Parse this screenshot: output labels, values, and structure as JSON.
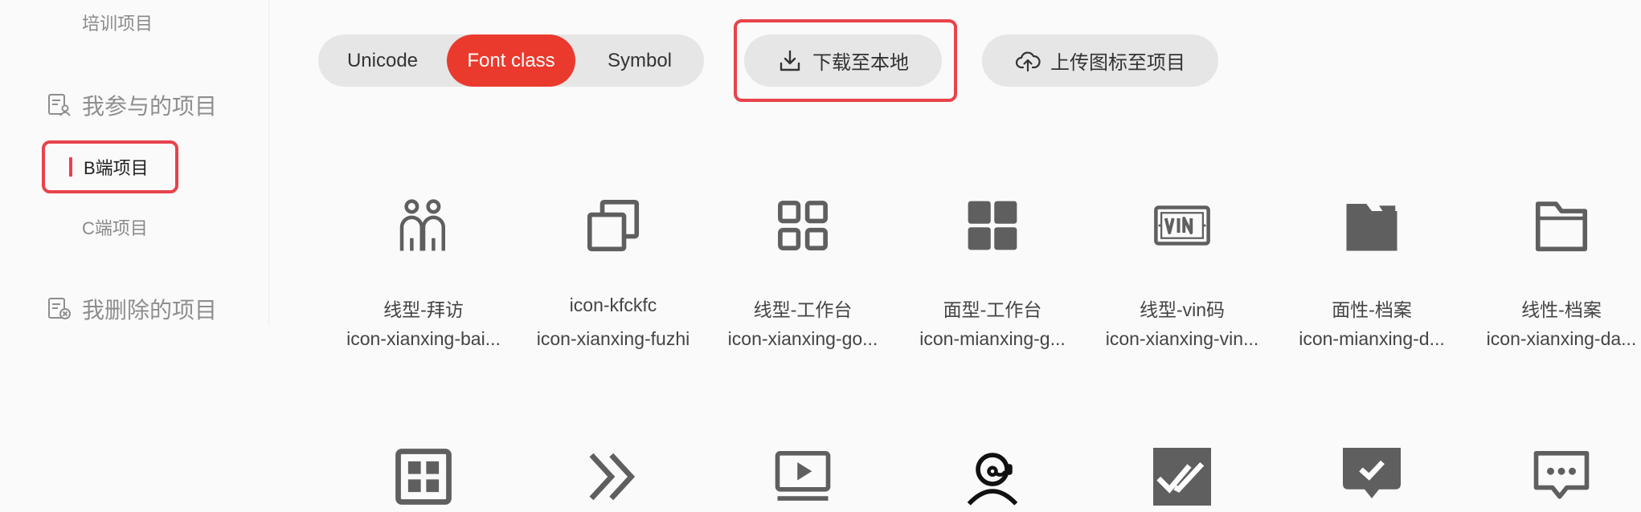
{
  "sidebar": {
    "top_link": "培训项目",
    "group_participated": "我参与的项目",
    "active_item": "B端项目",
    "item_c": "C端项目",
    "group_deleted": "我删除的项目"
  },
  "toolbar": {
    "tabs": [
      "Unicode",
      "Font class",
      "Symbol"
    ],
    "active_tab": "Font class",
    "download_label": "下载至本地",
    "upload_label": "上传图标至项目"
  },
  "icons": [
    {
      "name": "线型-拜访",
      "code": "icon-xianxing-bai...",
      "icon": "people-visit-icon"
    },
    {
      "name": "icon-kfckfc",
      "code": "icon-xianxing-fuzhi",
      "icon": "copy-icon"
    },
    {
      "name": "线型-工作台",
      "code": "icon-xianxing-go...",
      "icon": "workbench-outline-icon"
    },
    {
      "name": "面型-工作台",
      "code": "icon-mianxing-g...",
      "icon": "workbench-filled-icon"
    },
    {
      "name": "线型-vin码",
      "code": "icon-xianxing-vin...",
      "icon": "vin-code-icon"
    },
    {
      "name": "面性-档案",
      "code": "icon-mianxing-d...",
      "icon": "folder-filled-icon"
    },
    {
      "name": "线性-档案",
      "code": "icon-xianxing-da...",
      "icon": "folder-outline-icon"
    }
  ],
  "icons_row2": [
    {
      "icon": "grid-box-icon"
    },
    {
      "icon": "double-chevron-right-icon"
    },
    {
      "icon": "video-play-icon"
    },
    {
      "icon": "customer-service-icon"
    },
    {
      "icon": "double-check-icon"
    },
    {
      "icon": "check-message-icon"
    },
    {
      "icon": "chat-dots-icon"
    }
  ],
  "colors": {
    "accent": "#ea3a2e",
    "highlight_border": "#e8434b",
    "icon_gray": "#5f5f5f",
    "pill_bg": "#e6e6e6"
  }
}
